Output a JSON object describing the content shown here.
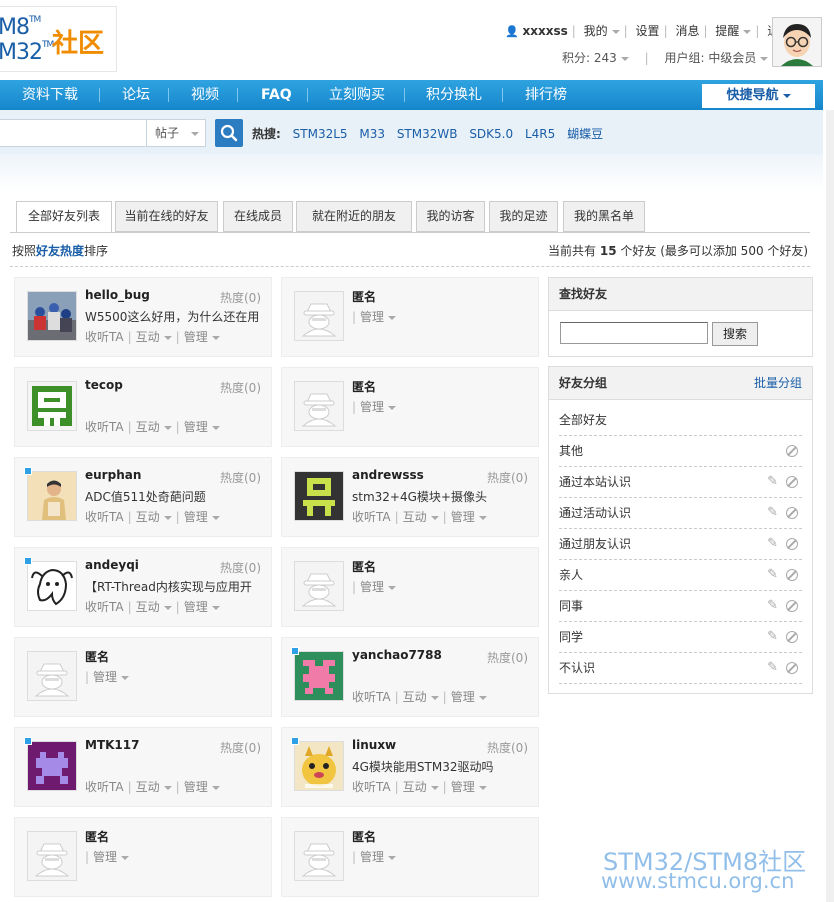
{
  "logo": {
    "line1": "M8",
    "line2": "M32",
    "tm": "TM",
    "brand": "社区"
  },
  "user": {
    "name": "xxxxss",
    "mine": "我的",
    "settings": "设置",
    "messages": "消息",
    "remind": "提醒",
    "logout": "退出",
    "points": "积分: 243",
    "group": "用户组: 中级会员"
  },
  "nav": {
    "items": [
      "资料下载",
      "论坛",
      "视频",
      "FAQ",
      "立刻购买",
      "积分换礼",
      "排行榜"
    ],
    "quick": "快捷导航"
  },
  "search": {
    "type": "帖子",
    "hot_label": "热搜:",
    "hot": [
      "STM32L5",
      "M33",
      "STM32WB",
      "SDK5.0",
      "L4R5",
      "蝴蝶豆"
    ]
  },
  "tabs": [
    "全部好友列表",
    "当前在线的好友",
    "在线成员",
    "就在附近的朋友",
    "我的访客",
    "我的足迹",
    "我的黑名单"
  ],
  "sort": {
    "prefix": "按照",
    "bold": "好友热度",
    "suffix": "排序"
  },
  "count": {
    "prefix": "当前共有",
    "num": "15",
    "suffix": "个好友 (最多可以添加 500 个好友)"
  },
  "actions": {
    "follow": "收听TA",
    "interact": "互动",
    "manage": "管理"
  },
  "friends": [
    {
      "name": "hello_bug",
      "heat": "热度(0)",
      "status": "W5500这么好用，为什么还在用",
      "online": false,
      "anon": false
    },
    {
      "name": "匿名",
      "anon": true
    },
    {
      "name": "tecop",
      "heat": "热度(0)",
      "status": "",
      "online": false,
      "anon": false
    },
    {
      "name": "匿名",
      "anon": true
    },
    {
      "name": "eurphan",
      "heat": "热度(0)",
      "status": "ADC值511处奇葩问题",
      "online": true,
      "anon": false
    },
    {
      "name": "andrewsss",
      "heat": "热度(0)",
      "status": "stm32+4G模块+摄像头",
      "online": false,
      "anon": false
    },
    {
      "name": "andeyqi",
      "heat": "热度(0)",
      "status": "【RT-Thread内核实现与应用开",
      "online": true,
      "anon": false
    },
    {
      "name": "匿名",
      "anon": true
    },
    {
      "name": "匿名",
      "anon": true
    },
    {
      "name": "yanchao7788",
      "heat": "热度(0)",
      "status": "",
      "online": true,
      "anon": false
    },
    {
      "name": "MTK117",
      "heat": "热度(0)",
      "status": "",
      "online": true,
      "anon": false
    },
    {
      "name": "linuxw",
      "heat": "热度(0)",
      "status": "4G模块能用STM32驱动吗",
      "online": true,
      "anon": false
    },
    {
      "name": "匿名",
      "anon": true
    },
    {
      "name": "匿名",
      "anon": true
    }
  ],
  "find": {
    "title": "查找好友",
    "button": "搜索"
  },
  "groups": {
    "title": "好友分组",
    "batch": "批量分组",
    "items": [
      "全部好友",
      "其他",
      "通过本站认识",
      "通过活动认识",
      "通过朋友认识",
      "亲人",
      "同事",
      "同学",
      "不认识"
    ]
  },
  "watermark": {
    "line1": "STM32/STM8社区",
    "line2": "www.stmcu.org.cn"
  },
  "colors": {
    "nav": "#1686cc",
    "link": "#1a5ea8",
    "online": "#2ea0e6"
  }
}
